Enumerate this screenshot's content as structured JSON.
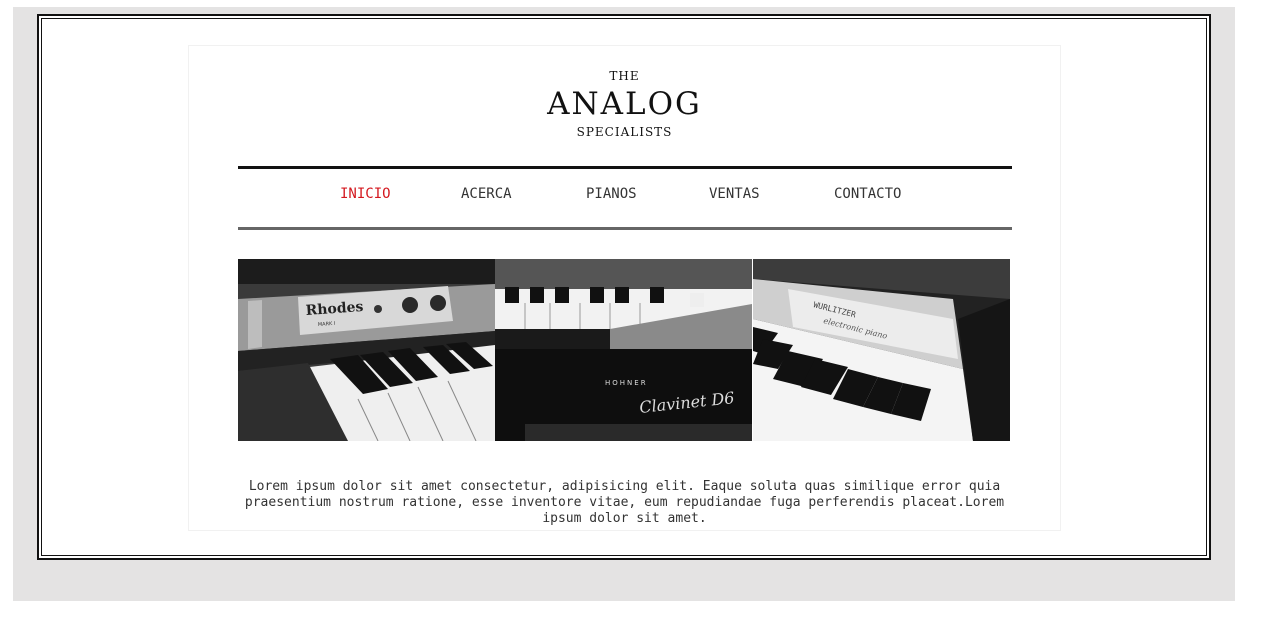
{
  "logo": {
    "top": "THE",
    "main": "ANALOG",
    "bottom": "SPECIALISTS"
  },
  "nav": {
    "items": [
      {
        "label": "INICIO",
        "active": true
      },
      {
        "label": "ACERCA",
        "active": false
      },
      {
        "label": "PIANOS",
        "active": false
      },
      {
        "label": "VENTAS",
        "active": false
      },
      {
        "label": "CONTACTO",
        "active": false
      }
    ]
  },
  "hero": {
    "panels": [
      {
        "brand": "Rhodes",
        "subtitle": "MARK I"
      },
      {
        "brand": "HOHNER",
        "subtitle": "Clavinet D6"
      },
      {
        "brand": "WURLITZER",
        "subtitle": "electronic piano"
      }
    ]
  },
  "blurb": "Lorem ipsum dolor sit amet consectetur, adipisicing elit. Eaque soluta quas similique error quia praesentium nostrum ratione, esse inventore vitae, eum repudiandae fuga perferendis placeat.Lorem ipsum dolor sit amet.",
  "colors": {
    "accent": "#d4181f",
    "page_bg": "#e4e3e3"
  }
}
